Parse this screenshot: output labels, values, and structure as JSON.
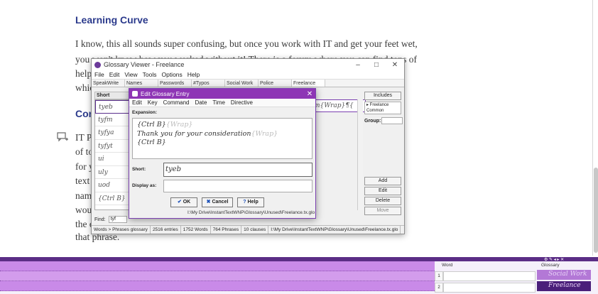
{
  "blog": {
    "heading": "Learning Curve",
    "subheading": "Com",
    "lines": [
      "I know, this all sounds super confusing, but once you work with IT and get your feet wet,",
      "you won't know how you worked without it!  There is a forum where you can find tons of",
      "help",
      "whic",
      "IT P",
      "of to",
      "for y",
      "text e",
      "name",
      "woul",
      "the e",
      "that phrase."
    ]
  },
  "glossary_viewer": {
    "title": "Glossary Viewer - Freelance",
    "window_controls": [
      "–",
      "□",
      "✕"
    ],
    "menu": [
      "File",
      "Edit",
      "View",
      "Tools",
      "Options",
      "Help"
    ],
    "tabs": [
      "SpeakWrite",
      "Names",
      "Passwords",
      "#Typos",
      "Social Work",
      "Police",
      "Freelance"
    ],
    "active_tab": "Freelance",
    "list_header": "Short",
    "list_items": [
      "tyeb",
      "tyfm",
      "tyfya",
      "tyfyt",
      "ui",
      "uly",
      "uod",
      "{Ctrl B}"
    ],
    "preview_text": "m{Wrap}¶{",
    "includes_label": "Includes",
    "includes_items": [
      "▸ Freelance",
      "Common"
    ],
    "group_label": "Group:",
    "action_buttons": [
      "Add",
      "Edit",
      "Delete",
      "Move"
    ],
    "find_label": "Find:",
    "find_value": "tyf",
    "status": [
      "Words > Phrases glossary",
      "2516 entries",
      "1752 Words",
      "764 Phrases",
      "10 clauses",
      "I:\\My Drive\\InstantTextWNP\\Glossary\\Unused\\Freelance.tx.glo"
    ]
  },
  "edit_dialog": {
    "title": "Edit Glossary Entry",
    "close": "✕",
    "menu": [
      "Edit",
      "Key",
      "Command",
      "Date",
      "Time",
      "Directive"
    ],
    "expansion_label": "Expansion:",
    "expansion_lines": [
      {
        "text": "{Ctrl B}",
        "ghost": "{Wrap}"
      },
      {
        "text": "Thank you for your consideration",
        "ghost": "{Wrap}"
      },
      {
        "text": "{Ctrl B}",
        "ghost": ""
      }
    ],
    "short_label": "Short:",
    "short_value": "tyeb",
    "display_label": "Display as:",
    "ok_label": "OK",
    "cancel_label": "Cancel",
    "help_label": "Help",
    "path": "I:\\My Drive\\InstantTextWNP\\Glossary\\Unused\\Freelance.tx.glo"
  },
  "taskbar": {
    "word_header": "Word",
    "glossary_header": "Glossary",
    "row_numbers": [
      "1",
      "2"
    ],
    "glossaries": [
      "Social Work",
      "Freelance"
    ]
  }
}
